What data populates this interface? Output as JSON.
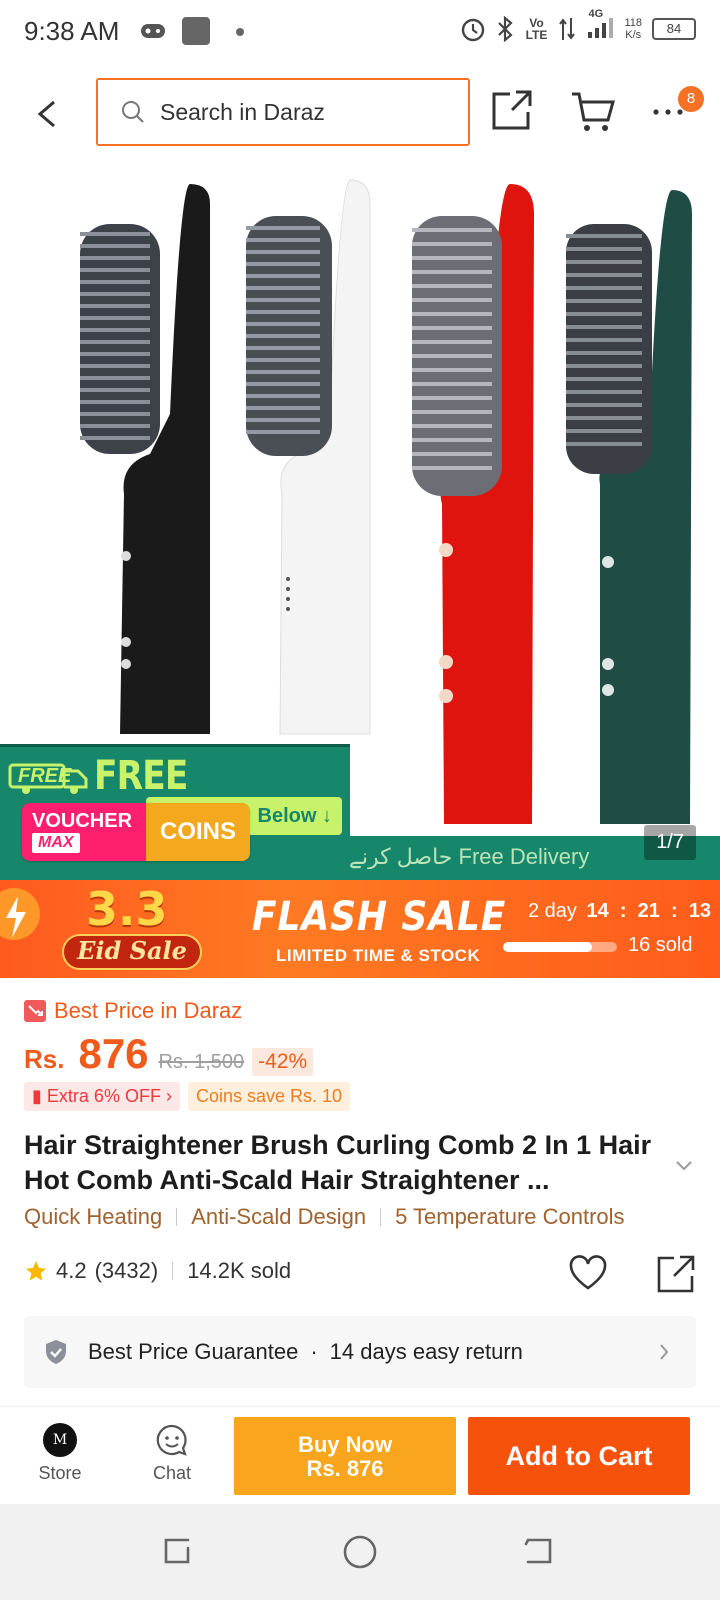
{
  "status_bar": {
    "time": "9:38 AM",
    "network_speed": "118",
    "network_speed_unit": "K/s",
    "battery": "84",
    "volte": "Vo LTE",
    "network_type": "4G"
  },
  "top_bar": {
    "search_placeholder": "Search in Daraz",
    "cart_badge_count": "8",
    "accent_color": "#f57224"
  },
  "product_image": {
    "counter": "1/7",
    "current_index": 1,
    "total": 7,
    "banner": {
      "free_tag": "FREE",
      "headline": "FREE DELIVERY",
      "below_text": "Below",
      "voucher_label": "VOUCHER",
      "voucher_sub": "MAX",
      "coins_label": "COINS",
      "strip_text": "Collect Voucher حاصل کرنے کے لیے نیچے دیے گئے Free Delivery"
    }
  },
  "flash_sale": {
    "promo_number": "3.3",
    "promo_name": "Eid Sale",
    "title": "FLASH SALE",
    "subtitle": "LIMITED TIME & STOCK",
    "countdown_days": "2 day",
    "countdown_hours": "14",
    "countdown_minutes": "21",
    "countdown_seconds": "13",
    "sold_label": "16 sold",
    "sold_fraction": 0.78
  },
  "pricing": {
    "best_price_label": "Best Price in Daraz",
    "currency": "Rs.",
    "price": "876",
    "original_price": "Rs. 1,500",
    "discount": "-42%",
    "extra_offer": "Extra 6% OFF",
    "coins_save": "Coins save Rs. 10"
  },
  "product": {
    "title": "Hair Straightener Brush Curling Comb 2 In 1 Hair Hot Comb Anti-Scald Hair Straightener ...",
    "features": [
      "Quick Heating",
      "Anti-Scald Design",
      "5 Temperature Controls"
    ],
    "rating": "4.2",
    "review_count": "(3432)",
    "sold": "14.2K sold",
    "guarantee": "Best Price Guarantee",
    "return_policy": "14 days easy return"
  },
  "action_bar": {
    "store_label": "Store",
    "chat_label": "Chat",
    "buy_now_label": "Buy Now",
    "buy_now_price": "Rs. 876",
    "add_to_cart_label": "Add to Cart",
    "store_logo_letter": "M"
  },
  "colors": {
    "buy_now": "#f9a61e",
    "add_to_cart": "#f7520c",
    "price": "#f05a1a",
    "feature_text": "#a0622f",
    "delivery_green": "#16876b"
  }
}
